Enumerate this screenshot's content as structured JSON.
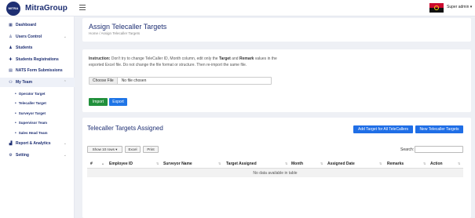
{
  "app": {
    "brand": "MitraGroup",
    "logo_text": "MITRA"
  },
  "header": {
    "user_label": "Super admin ▾"
  },
  "sidebar": {
    "items": [
      {
        "label": "Dashboard",
        "icon": "grid-icon"
      },
      {
        "label": "Users Control",
        "icon": "user-icon",
        "chevron": "⌄"
      },
      {
        "label": "Students",
        "icon": "students-icon"
      },
      {
        "label": "Students Registrations",
        "icon": "user-plus-icon"
      },
      {
        "label": "NATS Form Submissions",
        "icon": "document-icon"
      },
      {
        "label": "My Team",
        "icon": "team-icon",
        "chevron": "⌃"
      },
      {
        "label": "Report & Analytics",
        "icon": "chart-icon",
        "chevron": "⌄"
      },
      {
        "label": "Setting",
        "icon": "gear-icon",
        "chevron": "⌄"
      }
    ],
    "sub_items": [
      {
        "label": "Operator Target"
      },
      {
        "label": "Telecaller Target"
      },
      {
        "label": "Surveyor Target"
      },
      {
        "label": "Supervisor Team"
      },
      {
        "label": "Sales Head Team"
      }
    ]
  },
  "page": {
    "title": "Assign Telecaller Targets",
    "breadcrumb_home": "Home",
    "breadcrumb_sep": " / ",
    "breadcrumb_current": "Assign Telecaller Targets"
  },
  "upload": {
    "instruction_label": "Instruction:",
    "instruction_part1": " Don't try to change TeleCaller ID, Month column, edit only the ",
    "instruction_target": "Target",
    "instruction_and": " and ",
    "instruction_remark": "Remark",
    "instruction_part2": " values in the exported Excel file. Do not change the file format or structure. Then re-import the same file.",
    "choose_file_label": "Choose File",
    "file_status": "No file chosen",
    "import_label": "Import",
    "export_label": "Export"
  },
  "targets": {
    "section_title": "Telecaller Targets Assigned",
    "add_all_label": "Add Target for All TeleCallers",
    "new_label": "New Telecaller Targets",
    "show_rows_label": "Show 10 rows ▾",
    "excel_label": "Excel",
    "print_label": "Print",
    "search_label": "Search:",
    "columns": [
      "#",
      "Employee ID",
      "Surveyor Name",
      "Target Assigned",
      "Month",
      "Assigned Date",
      "Remarks",
      "Action"
    ],
    "empty_message": "No data available in table"
  },
  "colors": {
    "brand": "#1e2f73",
    "import": "#21903c",
    "primary": "#1f6ee6"
  }
}
